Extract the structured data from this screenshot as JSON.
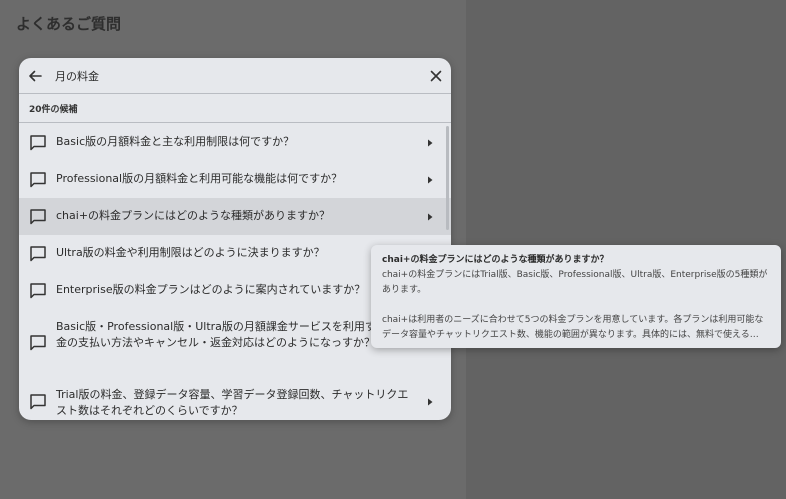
{
  "page": {
    "title": "よくあるご質問"
  },
  "search": {
    "value": "月の料金",
    "back_icon": "arrow-left-icon",
    "clear_icon": "close-icon"
  },
  "candidates": {
    "count_label": "20件の候補"
  },
  "items": [
    {
      "text": "Basic版の月額料金と主な利用制限は何ですか？"
    },
    {
      "text": "Professional版の月額料金と利用可能な機能は何ですか？"
    },
    {
      "text": "chai+の料金プランにはどのような種類がありますか？",
      "selected": true
    },
    {
      "text": "Ultra版の料金や利用制限はどのように決まりますか？"
    },
    {
      "text": "Enterprise版の料金プランはどのように案内されていますか？"
    },
    {
      "text": "Basic版・Professional版・Ultra版の月額課金サービスを利用す合、料金の支払い方法やキャンセル・返金対応はどのようになっすか？"
    },
    {
      "text": "Trial版の料金、登録データ容量、学習データ登録回数、チャットリクエスト数はそれぞれどのくらいですか？"
    }
  ],
  "tooltip": {
    "title": "chai+の料金プランにはどのような種類がありますか？",
    "line1": "chai+の料金プランにはTrial版、Basic版、Professional版、Ultra版、Enterprise版の5種類があります。",
    "line2": "chai+は利用者のニーズに合わせて5つの料金プランを用意しています。各プランは利用可能なデータ容量やチャットリクエスト数、機能の範囲が異なります。具体的には、無料で使える…"
  },
  "colors": {
    "backdrop": "#636363",
    "dialog": "#e6e8ec",
    "selected_row": "#d3d5d9",
    "text": "#2b2b2b"
  }
}
